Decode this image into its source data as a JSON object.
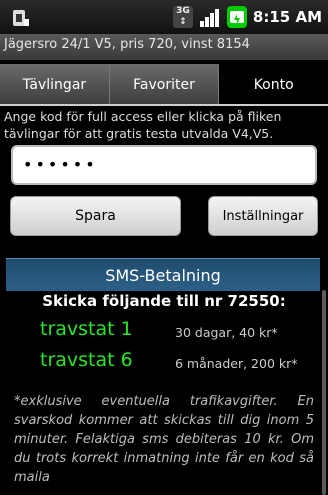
{
  "status": {
    "time": "8:15 AM",
    "network": "3G"
  },
  "title": "Jägersro 24/1 V5, pris 720, vinst 8154",
  "tabs": [
    {
      "label": "Tävlingar"
    },
    {
      "label": "Favoriter"
    },
    {
      "label": "Konto"
    }
  ],
  "info_text": "Ange kod för full access eller klicka på fliken tävlingar för att gratis testa utvalda V4,V5.",
  "password_value": "••••••",
  "buttons": {
    "save": "Spara",
    "settings": "Inställningar"
  },
  "sms": {
    "header": "SMS-Betalning",
    "send_text": "Skicka följande till  nr 72550:",
    "options": [
      {
        "name": "travstat 1",
        "desc": "30 dagar, 40 kr*"
      },
      {
        "name": "travstat 6",
        "desc": "6 månader, 200 kr*"
      }
    ],
    "footnote": "*exklusive eventuella trafikavgifter. En svarskod kommer att skickas till dig inom 5 minuter. Felaktiga sms debiteras 10 kr. Om du trots korrekt inmatning inte får en kod så maila"
  },
  "colors": {
    "accent_green": "#27e627",
    "sms_header": "#2d5f86"
  }
}
